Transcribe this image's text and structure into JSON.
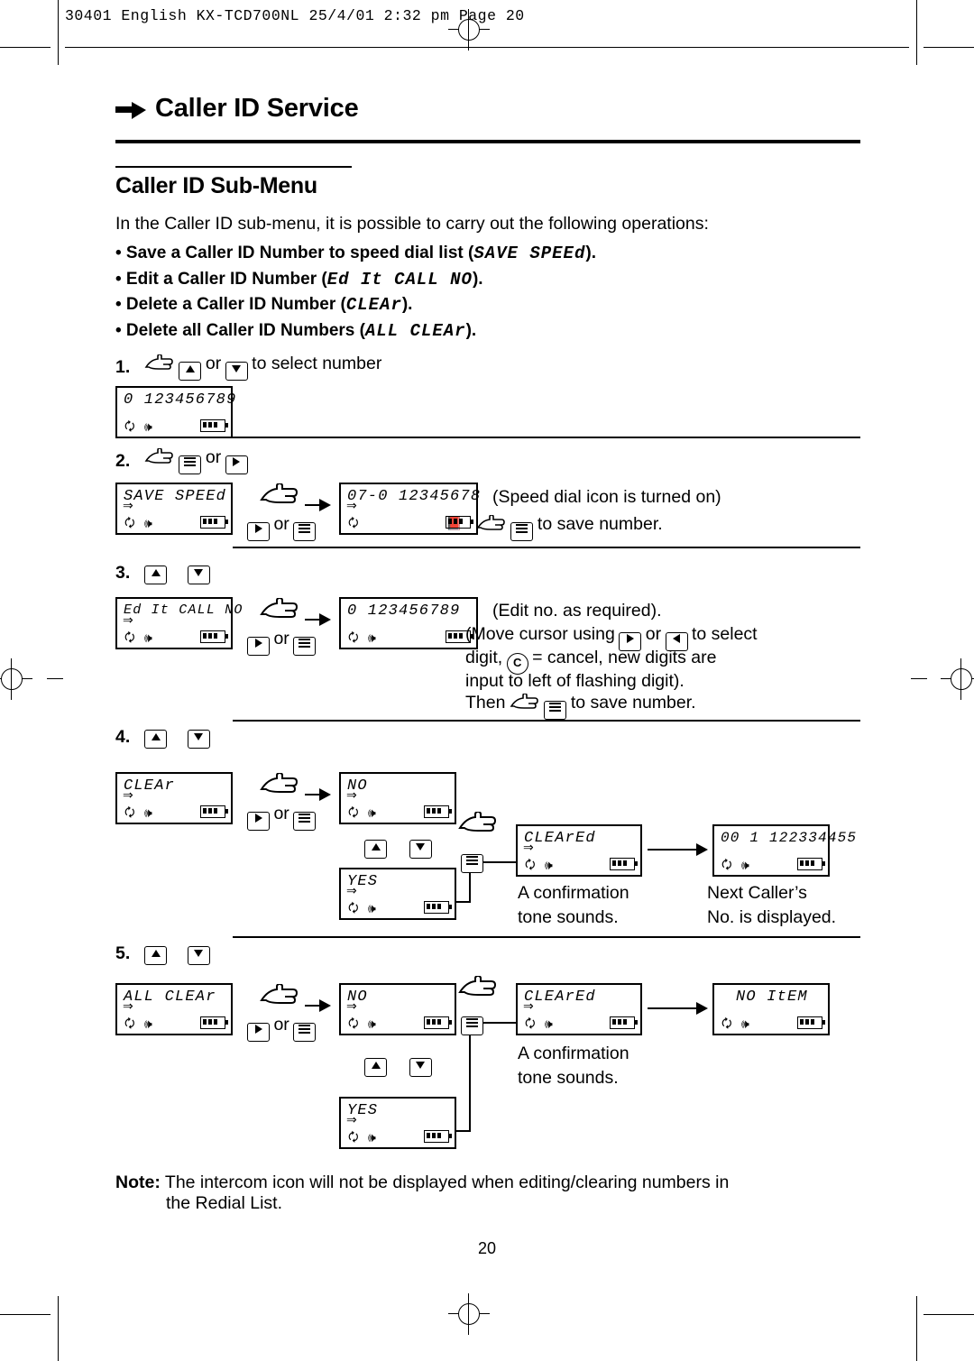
{
  "slug": "30401 English KX-TCD700NL  25/4/01  2:32 pm  Page 20",
  "chapter_title": "Caller ID Service",
  "subhead": "Caller ID Sub-Menu",
  "intro": "In the Caller ID sub-menu, it is possible to carry out the following operations:",
  "bullets": [
    {
      "text": "• Save a Caller ID Number to speed dial list (",
      "lcd": "SAVE SPEEd",
      "tail": ")."
    },
    {
      "text": "• Edit a Caller ID Number (",
      "lcd": "Ed It CALL NO",
      "tail": ")."
    },
    {
      "text": "• Delete a Caller ID Number (",
      "lcd": "CLEAr",
      "tail": ")."
    },
    {
      "text": "• Delete all Caller ID Numbers (",
      "lcd": "ALL CLEAr",
      "tail": ")."
    }
  ],
  "steps": {
    "s1": {
      "num": "1.",
      "text_or": "or",
      "text_tail": "to select number"
    },
    "s2": {
      "num": "2.",
      "text_or": "or"
    },
    "s3": {
      "num": "3."
    },
    "s4": {
      "num": "4."
    },
    "s5": {
      "num": "5."
    }
  },
  "lcds": {
    "l1": "0 123456789",
    "l2a": "SAVE SPEEd",
    "l2b": "07-0 12345678",
    "l3a": "Ed It CALL NO",
    "l3b": "0 123456789",
    "l4a": "CLEAr",
    "l4b": "NO",
    "l4c": "YES",
    "l4d": "CLEArEd",
    "l4e": "00 1 122334455",
    "l5a": "ALL CLEAr",
    "l5b": "NO",
    "l5c": "YES",
    "l5d": "CLEArEd",
    "l5e": "NO ItEM"
  },
  "captions": {
    "or_label": "or",
    "c2_1": "(Speed dial icon is turned on)",
    "c2_2": "to save number.",
    "c3_1": "(Edit no. as required).",
    "c3_2a": "(Move cursor using",
    "c3_2b": "or",
    "c3_2c": "to select",
    "c3_3a": "digit,",
    "c3_3b": "= cancel, new digits are",
    "c3_4": "input to left of flashing digit).",
    "c3_5a": "Then",
    "c3_5b": "to save number.",
    "c4_1": "A confirmation",
    "c4_2": "tone sounds.",
    "c4_3": "Next Caller’s",
    "c4_4": "No. is displayed.",
    "c5_1": "A confirmation",
    "c5_2": "tone sounds.",
    "cancel_key": "C"
  },
  "note": {
    "label": "Note:",
    "line1": "The intercom icon will not be displayed when editing/clearing numbers in",
    "line2": "the Redial List."
  },
  "page_number": "20"
}
